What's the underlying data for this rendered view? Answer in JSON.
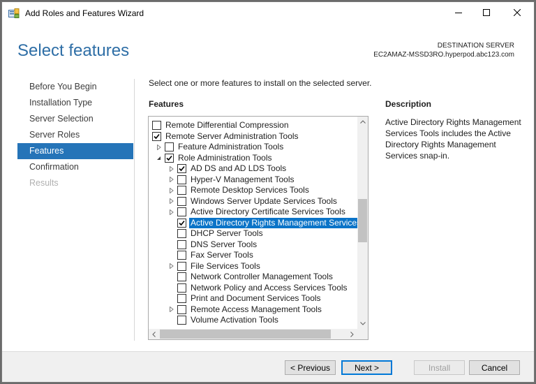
{
  "window": {
    "title": "Add Roles and Features Wizard",
    "controls": {
      "minimize": "minimize-icon",
      "maximize": "maximize-icon",
      "close": "close-icon"
    }
  },
  "page": {
    "title": "Select features",
    "destination_label": "DESTINATION SERVER",
    "destination_server": "EC2AMAZ-MSSD3RO.hyperpod.abc123.com"
  },
  "nav": {
    "items": [
      {
        "label": "Before You Begin",
        "state": "normal"
      },
      {
        "label": "Installation Type",
        "state": "normal"
      },
      {
        "label": "Server Selection",
        "state": "normal"
      },
      {
        "label": "Server Roles",
        "state": "normal"
      },
      {
        "label": "Features",
        "state": "active"
      },
      {
        "label": "Confirmation",
        "state": "normal"
      },
      {
        "label": "Results",
        "state": "disabled"
      }
    ]
  },
  "main": {
    "intro": "Select one or more features to install on the selected server.",
    "features_heading": "Features",
    "description_heading": "Description",
    "description_text": "Active Directory Rights Management Services Tools includes the Active Directory Rights Management Services snap-in."
  },
  "tree": {
    "items": [
      {
        "label": "Remote Differential Compression",
        "level": 0,
        "expander": "none",
        "checked": false,
        "selected": false
      },
      {
        "label": "Remote Server Administration Tools",
        "level": 0,
        "expander": "none",
        "checked": true,
        "selected": false
      },
      {
        "label": "Feature Administration Tools",
        "level": 1,
        "expander": "collapsed",
        "checked": false,
        "selected": false
      },
      {
        "label": "Role Administration Tools",
        "level": 1,
        "expander": "expanded",
        "checked": true,
        "selected": false
      },
      {
        "label": "AD DS and AD LDS Tools",
        "level": 2,
        "expander": "collapsed",
        "checked": true,
        "selected": false
      },
      {
        "label": "Hyper-V Management Tools",
        "level": 2,
        "expander": "collapsed",
        "checked": false,
        "selected": false
      },
      {
        "label": "Remote Desktop Services Tools",
        "level": 2,
        "expander": "collapsed",
        "checked": false,
        "selected": false
      },
      {
        "label": "Windows Server Update Services Tools",
        "level": 2,
        "expander": "collapsed",
        "checked": false,
        "selected": false
      },
      {
        "label": "Active Directory Certificate Services Tools",
        "level": 2,
        "expander": "collapsed",
        "checked": false,
        "selected": false
      },
      {
        "label": "Active Directory Rights Management Services",
        "level": 2,
        "expander": "none",
        "checked": true,
        "selected": true
      },
      {
        "label": "DHCP Server Tools",
        "level": 2,
        "expander": "none",
        "checked": false,
        "selected": false
      },
      {
        "label": "DNS Server Tools",
        "level": 2,
        "expander": "none",
        "checked": false,
        "selected": false
      },
      {
        "label": "Fax Server Tools",
        "level": 2,
        "expander": "none",
        "checked": false,
        "selected": false
      },
      {
        "label": "File Services Tools",
        "level": 2,
        "expander": "collapsed",
        "checked": false,
        "selected": false
      },
      {
        "label": "Network Controller Management Tools",
        "level": 2,
        "expander": "none",
        "checked": false,
        "selected": false
      },
      {
        "label": "Network Policy and Access Services Tools",
        "level": 2,
        "expander": "none",
        "checked": false,
        "selected": false
      },
      {
        "label": "Print and Document Services Tools",
        "level": 2,
        "expander": "none",
        "checked": false,
        "selected": false
      },
      {
        "label": "Remote Access Management Tools",
        "level": 2,
        "expander": "collapsed",
        "checked": false,
        "selected": false
      },
      {
        "label": "Volume Activation Tools",
        "level": 2,
        "expander": "none",
        "checked": false,
        "selected": false
      }
    ]
  },
  "footer": {
    "previous": "< Previous",
    "next": "Next >",
    "install": "Install",
    "cancel": "Cancel"
  },
  "colors": {
    "accent": "#2574b8",
    "selection": "#0b74c8",
    "title": "#2e6ea6"
  }
}
